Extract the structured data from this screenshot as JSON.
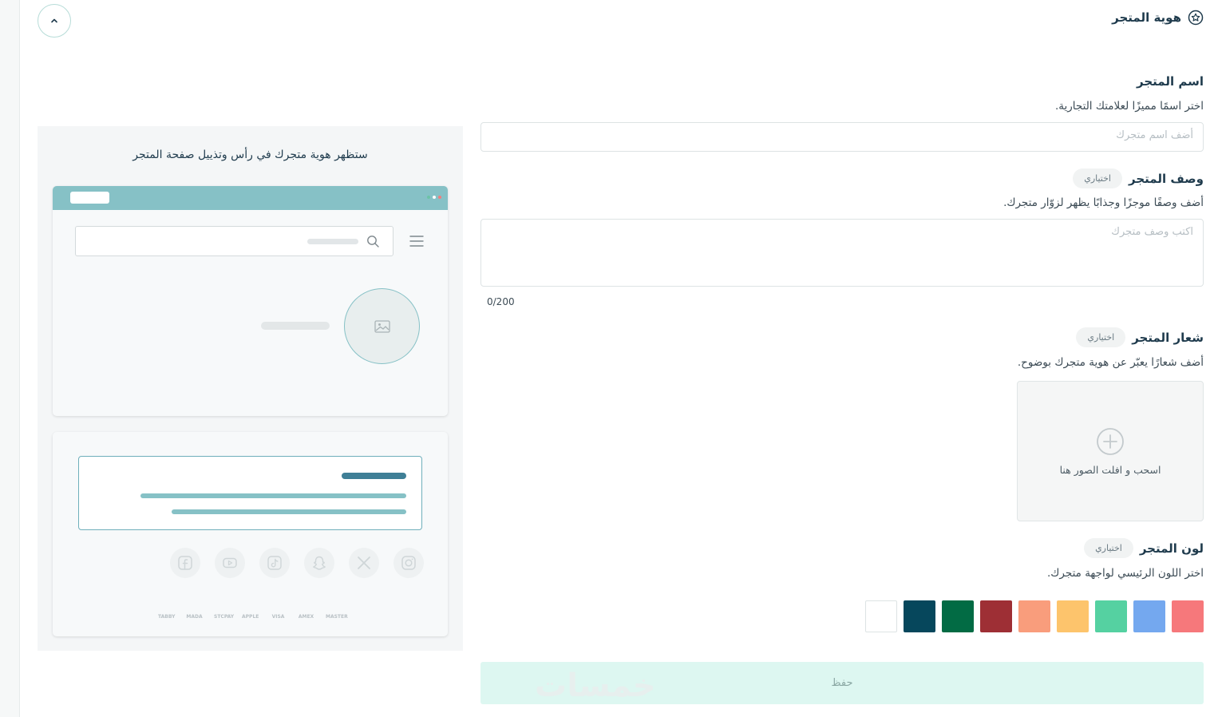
{
  "section": {
    "title": "هوية المتجر",
    "icon": "badge-star-icon"
  },
  "store_name": {
    "label": "اسم المتجر",
    "help": "اختر اسمًا مميزًا لعلامتك التجارية.",
    "placeholder": "أضف اسم متجرك"
  },
  "store_description": {
    "label": "وصف المتجر",
    "optional": "اختياري",
    "help": "أضف وصفًا موجزًا وجذابًا يظهر لزوّار متجرك.",
    "placeholder": "اكتب وصف متجرك",
    "counter": "0/200"
  },
  "store_logo": {
    "label": "شعار المتجر",
    "optional": "اختياري",
    "help": "أضف شعارًا يعبّر عن هوية متجرك بوضوح.",
    "dropzone_text": "اسحب و افلت الصور هنا"
  },
  "store_color": {
    "label": "لون المتجر",
    "optional": "اختياري",
    "help": "اختر اللون الرئيسي لواجهة متجرك.",
    "swatches": [
      "#f6787b",
      "#74a8ef",
      "#55d1a1",
      "#fdc46c",
      "#f99d7c",
      "#9e2f35",
      "#026b44",
      "#06475c",
      "#ffffff"
    ]
  },
  "save_label": "حفظ",
  "watermark": "خمسات",
  "preview": {
    "title": "ستظهر هوية متجرك في رأس وتذييل صفحة المتجر",
    "social_icons": [
      "instagram-icon",
      "x-icon",
      "snapchat-icon",
      "tiktok-icon",
      "youtube-icon",
      "facebook-icon"
    ],
    "payment_marks": [
      "TABBY",
      "MADA",
      "STCPAY",
      "APPLE",
      "VISA",
      "AMEX",
      "MASTER"
    ]
  }
}
